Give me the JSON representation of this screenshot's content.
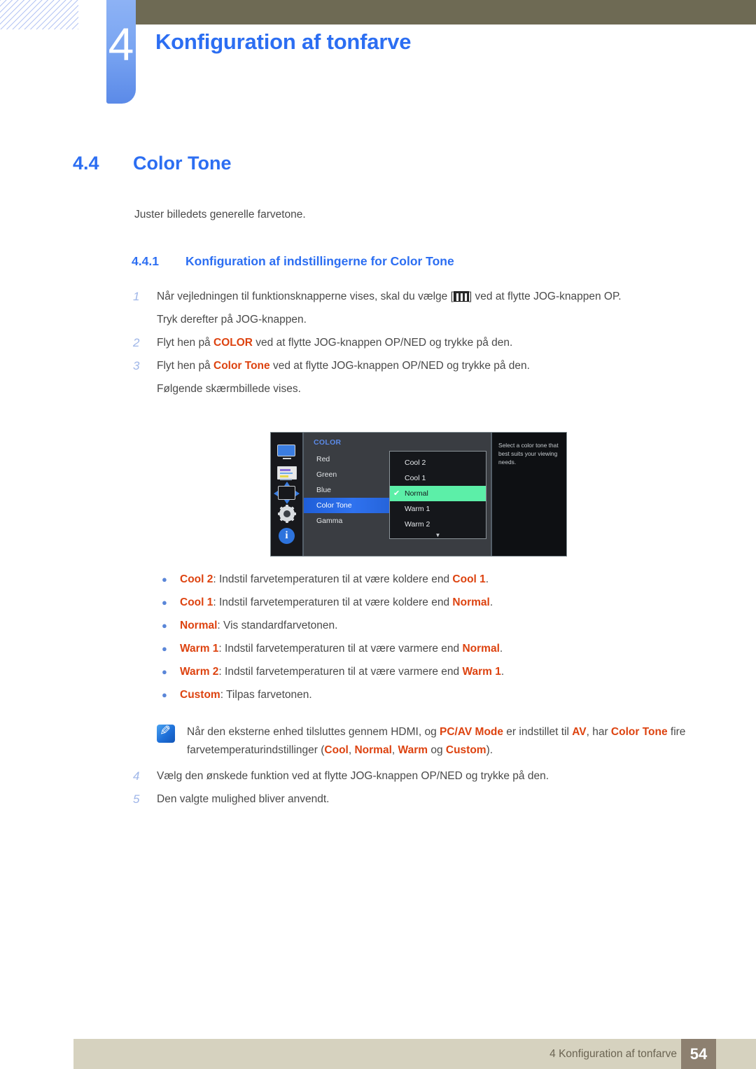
{
  "header": {
    "chapter_number": "4",
    "chapter_title": "Konfiguration af tonfarve"
  },
  "section": {
    "number": "4.4",
    "title": "Color Tone",
    "intro": "Juster billedets generelle farvetone."
  },
  "subsection": {
    "number": "4.4.1",
    "title": "Konfiguration af indstillingerne for Color Tone"
  },
  "steps": [
    {
      "num": "1",
      "pre": "Når vejledningen til funktionsknapperne vises, skal du vælge [",
      "post": "] ved at flytte JOG-knappen OP.",
      "continuation": "Tryk derefter på JOG-knappen."
    },
    {
      "num": "2",
      "pre": "Flyt hen på ",
      "highlight": "COLOR",
      "post": " ved at flytte JOG-knappen OP/NED og trykke på den."
    },
    {
      "num": "3",
      "pre": "Flyt hen på ",
      "highlight": "Color Tone",
      "post": " ved at flytte JOG-knappen OP/NED og trykke på den.",
      "continuation": "Følgende skærmbillede vises."
    }
  ],
  "steps_final": [
    {
      "num": "4",
      "text": "Vælg den ønskede funktion ved at flytte JOG-knappen OP/NED og trykke på den."
    },
    {
      "num": "5",
      "text": "Den valgte mulighed bliver anvendt."
    }
  ],
  "osd": {
    "menu_title": "COLOR",
    "menu_items": [
      "Red",
      "Green",
      "Blue",
      "Color Tone",
      "Gamma"
    ],
    "selected_item": "Color Tone",
    "dropdown_options": [
      "Cool 2",
      "Cool 1",
      "Normal",
      "Warm 1",
      "Warm 2"
    ],
    "dropdown_checked": "Normal",
    "dropdown_more_indicator": "▼",
    "help_text": "Select a color tone that best suits your viewing needs.",
    "icons": [
      "monitor-icon",
      "color-bars-icon",
      "position-arrows-icon",
      "gear-icon",
      "info-icon"
    ],
    "colors": {
      "selected_row": "#2f72ef",
      "checked_row": "#5cefa8",
      "title_blue": "#5b8ae8",
      "panel_bg": "#3a3d42"
    }
  },
  "bullets": [
    {
      "marker": "●",
      "term": "Cool 2",
      "mid": ": Indstil farvetemperaturen til at være koldere end ",
      "term2": "Cool 1",
      "end": "."
    },
    {
      "marker": "●",
      "term": "Cool 1",
      "mid": ": Indstil farvetemperaturen til at være koldere end ",
      "term2": "Normal",
      "end": "."
    },
    {
      "marker": "●",
      "term": "Normal",
      "mid": ": Vis standardfarvetonen.",
      "term2": "",
      "end": ""
    },
    {
      "marker": "●",
      "term": "Warm 1",
      "mid": ": Indstil farvetemperaturen til at være varmere end ",
      "term2": "Normal",
      "end": "."
    },
    {
      "marker": "●",
      "term": "Warm 2",
      "mid": ": Indstil farvetemperaturen til at være varmere end ",
      "term2": "Warm 1",
      "end": "."
    },
    {
      "marker": "●",
      "term": "Custom",
      "mid": ": Tilpas farvetonen.",
      "term2": "",
      "end": ""
    }
  ],
  "note": {
    "icon": "note-pencil-icon",
    "p1": "Når den eksterne enhed tilsluttes gennem HDMI, og ",
    "t1": "PC/AV Mode",
    "p2": " er indstillet til ",
    "t2": "AV",
    "p3": ", har ",
    "t3": "Color Tone",
    "p4": " fire farvetemperaturindstillinger (",
    "t4": "Cool",
    "p5": ", ",
    "t5": "Normal",
    "p6": ", ",
    "t6": "Warm",
    "p7": " og ",
    "t7": "Custom",
    "p8": ")."
  },
  "footer": {
    "text": "4 Konfiguration af tonfarve",
    "page": "54"
  },
  "colors": {
    "accent_blue": "#2c6ef2",
    "highlight_orange": "#dd4310",
    "olive": "#6e6a54",
    "footer_beige": "#d6d2bf",
    "footer_page_bg": "#8d8070"
  }
}
